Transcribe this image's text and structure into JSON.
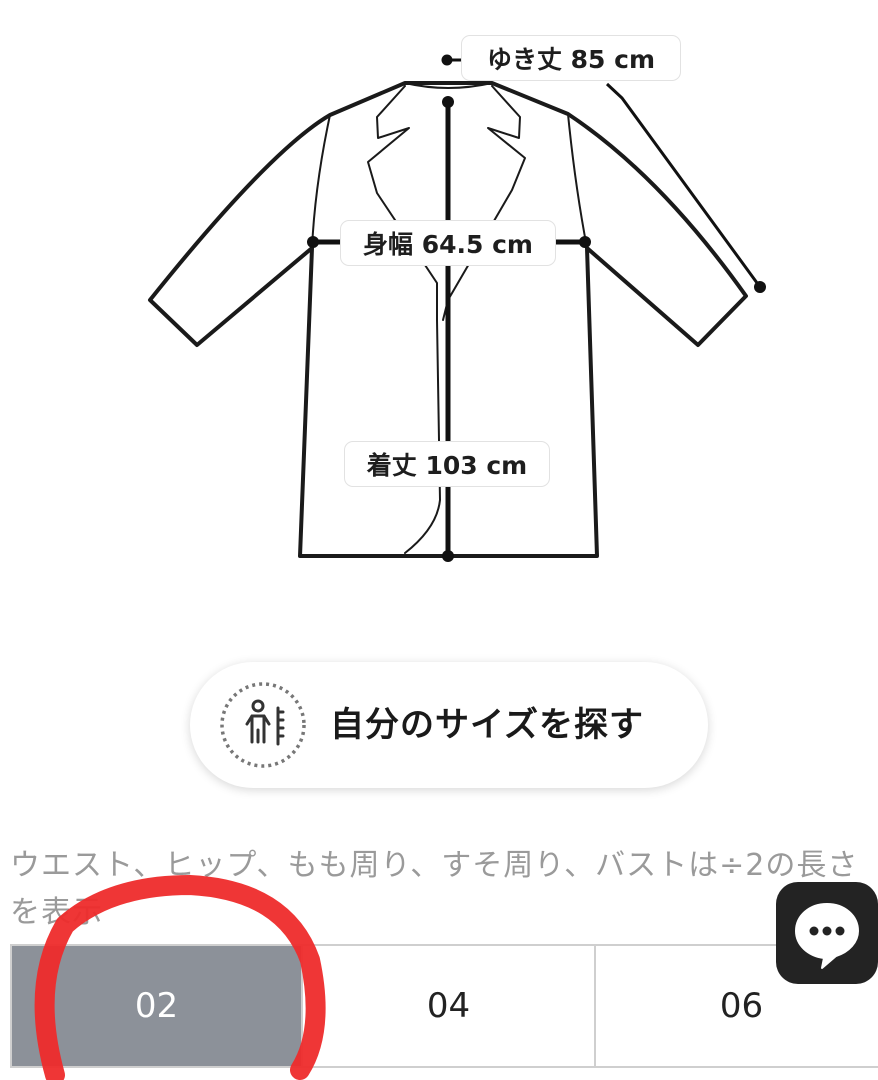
{
  "diagram": {
    "sleeve_length": "ゆき丈 85 cm",
    "chest_width": "身幅 64.5 cm",
    "body_length": "着丈 103 cm"
  },
  "find_size_button": {
    "label": "自分のサイズを探す",
    "icon": "body-measure-icon"
  },
  "note": "ウエスト、ヒップ、もも周り、すそ周り、バストは÷2の長さを表示",
  "sizes": {
    "options": [
      "02",
      "04",
      "06"
    ],
    "selected": "02"
  },
  "chat": {
    "icon": "chat-bubble-icon"
  },
  "colors": {
    "selected_size_bg": "#8c9199",
    "annotation_circle": "#ee2b2b",
    "chat_button_bg": "#232323"
  }
}
